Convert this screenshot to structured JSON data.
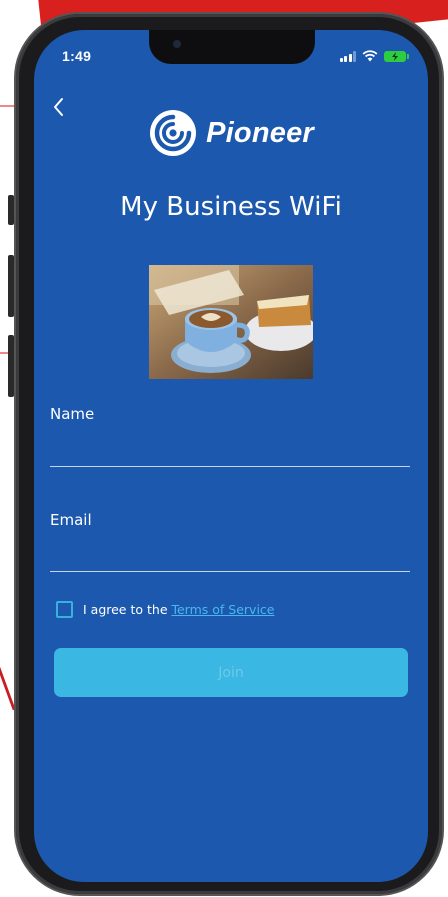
{
  "status_bar": {
    "time": "1:49",
    "battery_color": "#2ecc40"
  },
  "nav": {
    "back_icon": "chevron-left-icon"
  },
  "brand": {
    "name": "Pioneer",
    "logo_icon": "pioneer-swirl-logo"
  },
  "page": {
    "title": "My Business WiFi",
    "hero_image": "coffee-latte-and-cake-photo"
  },
  "form": {
    "name_label": "Name",
    "name_value": "",
    "email_label": "Email",
    "email_value": "",
    "agree_prefix": "I agree to the ",
    "terms_link": "Terms of Service",
    "agree_checked": false,
    "join_label": "Join"
  },
  "colors": {
    "screen_background": "#1c58ad",
    "join_button": "#3ab7e2",
    "link": "#48b8ee",
    "accent_red": "#d8201e"
  }
}
